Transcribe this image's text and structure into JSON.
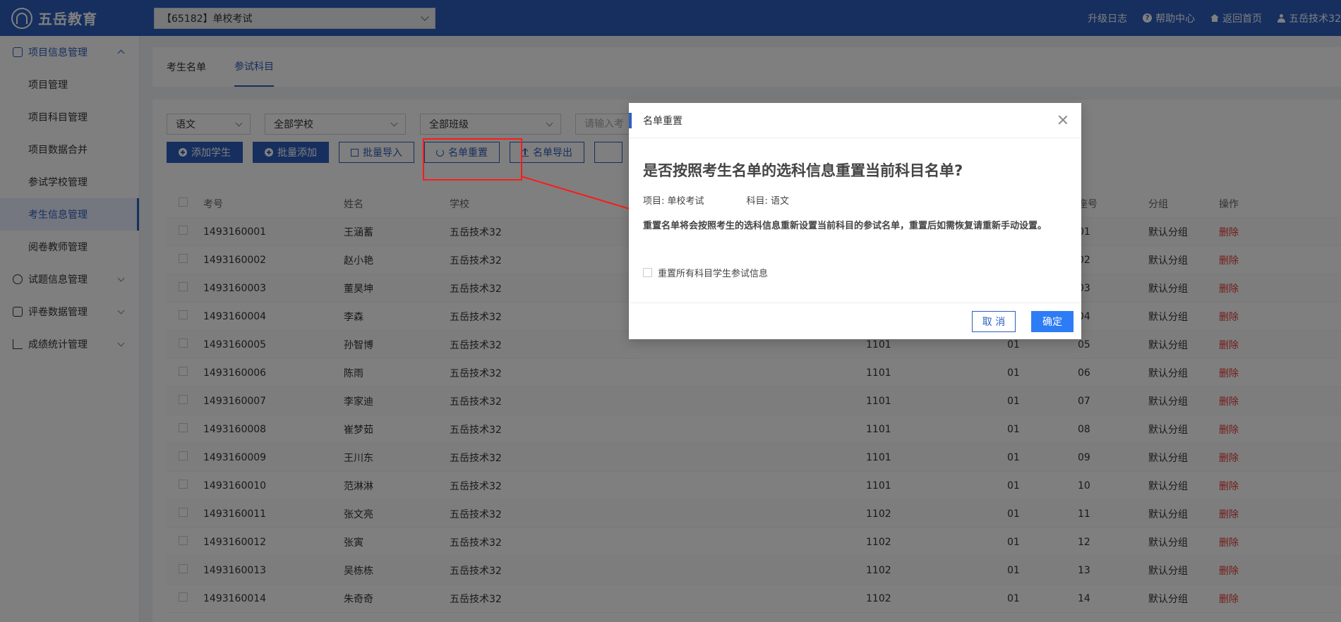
{
  "header": {
    "logo_text": "五岳教育",
    "project_select": "【65182】单校考试",
    "links": {
      "changelog": "升级日志",
      "help": "帮助中心",
      "home": "返回首页",
      "user": "五岳技术32"
    },
    "bg_color": "#2d5fbf"
  },
  "sidebar": {
    "group_project": "项目信息管理",
    "items": [
      {
        "label": "项目管理"
      },
      {
        "label": "项目科目管理"
      },
      {
        "label": "项目数据合并"
      },
      {
        "label": "参试学校管理"
      },
      {
        "label": "考生信息管理"
      },
      {
        "label": "阅卷教师管理"
      }
    ],
    "active_item": "考生信息管理",
    "group_questions": "试题信息管理",
    "group_marking": "评卷数据管理",
    "group_stats": "成绩统计管理"
  },
  "tabs": [
    {
      "label": "考生名单"
    },
    {
      "label": "参试科目"
    }
  ],
  "filters": {
    "subject": "语文",
    "school": "全部学校",
    "class": "全部班级",
    "search_placeholder": "请输入考"
  },
  "toolbar": {
    "add_student": "添加学生",
    "batch_add": "批量添加",
    "batch_import": "批量导入",
    "reset_list": "名单重置",
    "export_list": "名单导出"
  },
  "table": {
    "headers": {
      "id": "考号",
      "name": "姓名",
      "school": "学校",
      "seat": "座号",
      "group": "分组",
      "op": "操作"
    },
    "rows": [
      {
        "id": "1493160001",
        "name": "王涵蓄",
        "school": "五岳技术32",
        "class": "",
        "room": "",
        "seat": "01",
        "group": "默认分组",
        "op": "删除"
      },
      {
        "id": "1493160002",
        "name": "赵小艳",
        "school": "五岳技术32",
        "class": "",
        "room": "",
        "seat": "02",
        "group": "默认分组",
        "op": "删除"
      },
      {
        "id": "1493160003",
        "name": "董昊坤",
        "school": "五岳技术32",
        "class": "",
        "room": "",
        "seat": "03",
        "group": "默认分组",
        "op": "删除"
      },
      {
        "id": "1493160004",
        "name": "李森",
        "school": "五岳技术32",
        "class": "",
        "room": "",
        "seat": "04",
        "group": "默认分组",
        "op": "删除"
      },
      {
        "id": "1493160005",
        "name": "孙智博",
        "school": "五岳技术32",
        "class": "1101",
        "room": "01",
        "seat": "05",
        "group": "默认分组",
        "op": "删除"
      },
      {
        "id": "1493160006",
        "name": "陈雨",
        "school": "五岳技术32",
        "class": "1101",
        "room": "01",
        "seat": "06",
        "group": "默认分组",
        "op": "删除"
      },
      {
        "id": "1493160007",
        "name": "李家迪",
        "school": "五岳技术32",
        "class": "1101",
        "room": "01",
        "seat": "07",
        "group": "默认分组",
        "op": "删除"
      },
      {
        "id": "1493160008",
        "name": "崔梦茹",
        "school": "五岳技术32",
        "class": "1101",
        "room": "01",
        "seat": "08",
        "group": "默认分组",
        "op": "删除"
      },
      {
        "id": "1493160009",
        "name": "王川东",
        "school": "五岳技术32",
        "class": "1101",
        "room": "01",
        "seat": "09",
        "group": "默认分组",
        "op": "删除"
      },
      {
        "id": "1493160010",
        "name": "范淋淋",
        "school": "五岳技术32",
        "class": "1101",
        "room": "01",
        "seat": "10",
        "group": "默认分组",
        "op": "删除"
      },
      {
        "id": "1493160011",
        "name": "张文亮",
        "school": "五岳技术32",
        "class": "1102",
        "room": "01",
        "seat": "11",
        "group": "默认分组",
        "op": "删除"
      },
      {
        "id": "1493160012",
        "name": "张寅",
        "school": "五岳技术32",
        "class": "1102",
        "room": "01",
        "seat": "12",
        "group": "默认分组",
        "op": "删除"
      },
      {
        "id": "1493160013",
        "name": "吴栋栋",
        "school": "五岳技术32",
        "class": "1102",
        "room": "01",
        "seat": "13",
        "group": "默认分组",
        "op": "删除"
      },
      {
        "id": "1493160014",
        "name": "朱奇奇",
        "school": "五岳技术32",
        "class": "1102",
        "room": "01",
        "seat": "14",
        "group": "默认分组",
        "op": "删除"
      }
    ]
  },
  "modal": {
    "title": "名单重置",
    "question": "是否按照考生名单的选科信息重置当前科目名单?",
    "project_label": "项目: 单校考试",
    "subject_label": "科目: 语文",
    "description": "重置名单将会按照考生的选科信息重新设置当前科目的参试名单，重置后如需恢复请重新手动设置。",
    "checkbox_label": "重置所有科目学生参试信息",
    "cancel": "取 消",
    "confirm": "确定"
  },
  "annotation": {
    "color": "#ff1a1a"
  }
}
